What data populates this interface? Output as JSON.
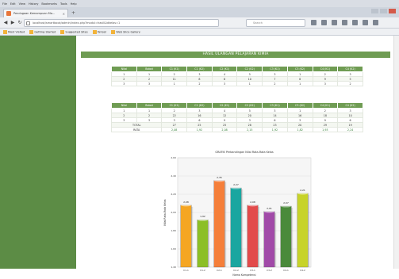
{
  "browser": {
    "menu": [
      "File",
      "Edit",
      "View",
      "History",
      "Bookmarks",
      "Tools",
      "Help"
    ],
    "tab_title": "Pendugaan Kemampuan Ma...",
    "url": "localhost/smartbook/admin/index.php?modul=hasil&idkelas=1",
    "search_placeholder": "Search",
    "bookmarks": [
      "Most Visited",
      "Getting Started",
      "Suggested Sites",
      "Yahoo!",
      "Web Slice Gallery"
    ]
  },
  "page": {
    "title": "HASIL ULANGAN PELAJARAN KIMIA"
  },
  "table1": {
    "headers": [
      "Nilai",
      "Bobot",
      "C1 (K1)",
      "C1 (K2)",
      "C2 (K1)",
      "C2 (K2)",
      "C3 (K1)",
      "C3 (K2)",
      "C4 (K1)",
      "C4 (K2)"
    ],
    "rows": [
      [
        "1",
        "1",
        "2",
        "3",
        "4",
        "5",
        "3",
        "1",
        "2",
        "3"
      ],
      [
        "2",
        "2",
        "11",
        "8",
        "6",
        "10",
        "7",
        "8",
        "9",
        "5"
      ],
      [
        "3",
        "3",
        "1",
        "2",
        "3",
        "1",
        "2",
        "1",
        "3",
        "2"
      ]
    ]
  },
  "table2": {
    "headers": [
      "Nilai",
      "Bobot",
      "C1 (K1)",
      "C1 (K2)",
      "C2 (K1)",
      "C2 (K2)",
      "C3 (K1)",
      "C3 (K2)",
      "C4 (K1)",
      "C4 (K2)"
    ],
    "rows": [
      [
        "1",
        "1",
        "2",
        "3",
        "4",
        "5",
        "3",
        "1",
        "2",
        "3"
      ],
      [
        "2",
        "2",
        "22",
        "16",
        "12",
        "20",
        "14",
        "16",
        "18",
        "10"
      ],
      [
        "3",
        "3",
        "3",
        "6",
        "9",
        "3",
        "6",
        "3",
        "9",
        "6"
      ]
    ],
    "total_label": "TOTAL",
    "totals": [
      "27",
      "25",
      "25",
      "28",
      "23",
      "20",
      "29",
      "19"
    ],
    "mean_label": "RATA",
    "means": [
      "2,08",
      "1,92",
      "2,08",
      "2,15",
      "1,92",
      "1,82",
      "1,93",
      "2,24"
    ]
  },
  "chart_data": {
    "type": "bar",
    "title": "GRAFIK Perbandingan Nilai Rata-Rata Kelas",
    "xlabel": "Nama Kompetensi",
    "ylabel": "Nilai Rata-Rata Kelas",
    "categories": [
      "C1-1",
      "C1-2",
      "C2-1",
      "C2-2",
      "C3-1",
      "C3-2",
      "C4-1",
      "C4-2"
    ],
    "values": [
      2.08,
      1.92,
      2.35,
      2.27,
      2.08,
      2.01,
      2.07,
      2.21
    ],
    "value_labels": [
      "2,08",
      "1,92",
      "2,35",
      "2,27",
      "2,08",
      "2,01",
      "2,07",
      "2,21"
    ],
    "ylim": [
      1.4,
      2.6
    ],
    "yticks": [
      "1,40",
      "1,60",
      "1,80",
      "2,00",
      "2,20",
      "2,40",
      "2,60"
    ],
    "colors": [
      "#f5a623",
      "#8cbf26",
      "#f57f3a",
      "#1aa6a0",
      "#e24b4b",
      "#a14aa8",
      "#4a8a3b",
      "#c7d32a"
    ],
    "grid": true,
    "legend": "none"
  }
}
